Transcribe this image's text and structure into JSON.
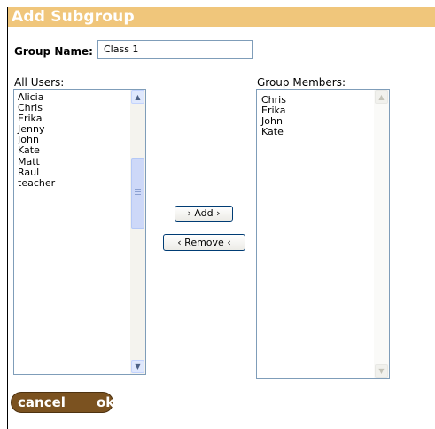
{
  "header": {
    "title": "Add Subgroup"
  },
  "group_name": {
    "label": "Group Name:",
    "value": "Class 1"
  },
  "all_users": {
    "label": "All Users:",
    "items": [
      "Alicia",
      "Chris",
      "Erika",
      "Jenny",
      "John",
      "Kate",
      "Matt",
      "Raul",
      "teacher"
    ]
  },
  "group_members": {
    "label": "Group Members:",
    "items": [
      "Chris",
      "Erika",
      "John",
      "Kate"
    ]
  },
  "buttons": {
    "add": "› Add ›",
    "remove": "‹ Remove ‹"
  },
  "footer": {
    "cancel": "cancel",
    "ok": "ok"
  },
  "colors": {
    "header_bg": "#f0c67b",
    "pill_bg": "#7b5220"
  },
  "icons": {
    "scroll_up": "triangle-up-icon",
    "scroll_down": "triangle-down-icon",
    "grip": "scrollbar-grip-icon"
  }
}
